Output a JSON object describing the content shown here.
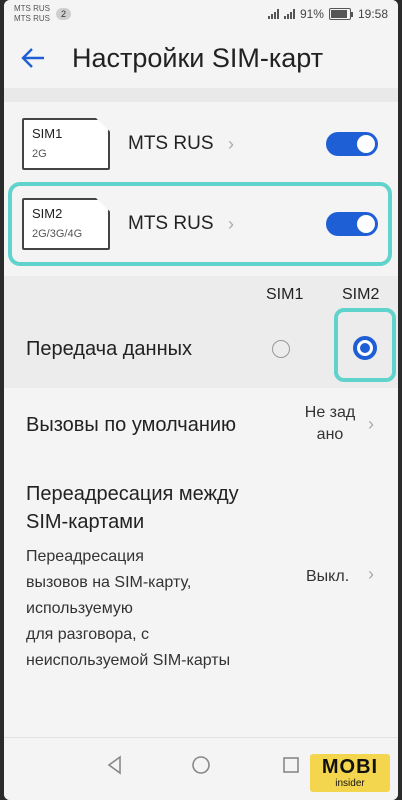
{
  "status_bar": {
    "carrier1": "MTS RUS",
    "carrier2": "MTS RUS",
    "badge": "2",
    "battery": "91%",
    "time": "19:58"
  },
  "header": {
    "title": "Настройки SIM-карт"
  },
  "sim_cards": [
    {
      "slot": "SIM1",
      "network": "2G",
      "operator": "MTS RUS",
      "enabled": true
    },
    {
      "slot": "SIM2",
      "network": "2G/3G/4G",
      "operator": "MTS RUS",
      "enabled": true
    }
  ],
  "columns": {
    "sim1": "SIM1",
    "sim2": "SIM2"
  },
  "data_transfer": {
    "label": "Передача данных",
    "selected": "SIM2"
  },
  "default_calls": {
    "label": "Вызовы по умолчанию",
    "value_line1": "Не зад",
    "value_line2": "ано"
  },
  "forwarding": {
    "title_line1": "Переадресация между",
    "title_line2": "SIM-картами",
    "desc_lines": [
      "Переадресация",
      "вызовов на SIM-карту,",
      "используемую",
      "для разговора, с",
      "неиспользуемой SIM-карты"
    ],
    "value": "Выкл."
  },
  "watermark": {
    "line1": "MOBI",
    "line2": "insider"
  },
  "colors": {
    "accent": "#1f5fd6",
    "highlight": "#5fd3cc",
    "watermark": "#f4d64e"
  }
}
